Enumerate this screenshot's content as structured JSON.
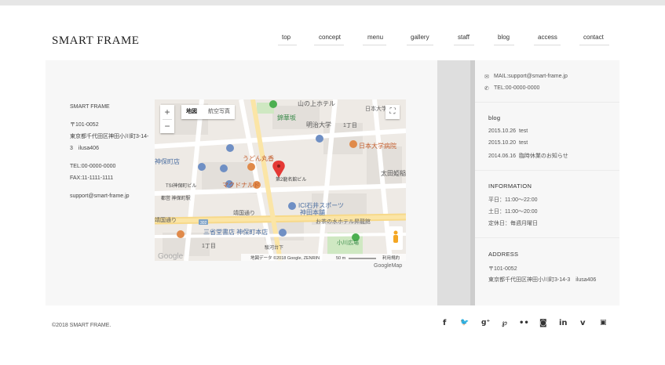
{
  "site": {
    "logo": "SMART FRAME"
  },
  "nav": {
    "items": [
      "top",
      "concept",
      "menu",
      "gallery",
      "staff",
      "blog",
      "access",
      "contact"
    ]
  },
  "address_block": {
    "name": "SMART FRAME",
    "postal": "〒101-0052",
    "address_line1": "東京都千代田区神田小川町3-14-",
    "address_line2": "3　ilusa406",
    "tel": "TEL:00-0000-0000",
    "fax": "FAX:11-1111-1111",
    "email": "support@smart-frame.jp"
  },
  "map": {
    "type_map": "地図",
    "type_satellite": "航空写真",
    "zoom_in": "+",
    "zoom_out": "−",
    "fullscreen": "⛶",
    "attribution": "地図データ ©2018 Google, ZENRIN",
    "scale": "50 m",
    "terms": "利用規約",
    "google": "Google",
    "caption": "GoogleMap",
    "labels": {
      "l1": "山の上ホテル",
      "l2": "日本大学",
      "l3": "錦華坂",
      "l4": "明治大学",
      "l5": "1丁目",
      "l6": "日本大学病院",
      "l7": "神保町店",
      "l8": "うどん丸香",
      "l9": "太田姫稲",
      "l10": "マクドナルド",
      "l11": "第2龍名館ビル",
      "l12": "TSI神保町ビル",
      "l13": "都営 神保町駅",
      "l14": "ICI石井スポーツ",
      "l15": "神田本舗",
      "l16": "靖国通り",
      "l17": "お茶の水ホテル昇龍館",
      "l18": "三省堂書店 神保町本店",
      "l19": "1丁目",
      "l20": "小川広場",
      "l21": "駿河台下",
      "l22": "靖国通り",
      "road": "302"
    }
  },
  "sidebar": {
    "mail": "MAIL:support@smart-frame.jp",
    "tel": "TEL:00-0000-0000",
    "blog": {
      "heading": "blog",
      "posts": [
        {
          "date": "2015.10.26",
          "title": "test"
        },
        {
          "date": "2015.10.20",
          "title": "test"
        },
        {
          "date": "2014.06.16",
          "title": "臨時休業のお知らせ"
        }
      ]
    },
    "information": {
      "heading": "INFORMATION",
      "lines": [
        "平日：11:00〜22:00",
        "土日：11:00〜20:00",
        "定休日：毎週月曜日"
      ]
    },
    "address": {
      "heading": "ADDRESS",
      "lines": [
        "〒101-0052",
        "東京都千代田区神田小川町3-14-3　ilusa406"
      ]
    }
  },
  "footer": {
    "copyright": "©2018 SMART FRAME.",
    "social": [
      {
        "icon": "facebook-icon",
        "glyph": "f"
      },
      {
        "icon": "twitter-icon",
        "glyph": "🐦"
      },
      {
        "icon": "google-plus-icon",
        "glyph": "g⁺"
      },
      {
        "icon": "pinterest-icon",
        "glyph": "℘"
      },
      {
        "icon": "flickr-icon",
        "glyph": "••"
      },
      {
        "icon": "instagram-icon",
        "glyph": "◙"
      },
      {
        "icon": "linkedin-icon",
        "glyph": "in"
      },
      {
        "icon": "vimeo-icon",
        "glyph": "v"
      },
      {
        "icon": "youtube-icon",
        "glyph": "▣"
      }
    ]
  }
}
